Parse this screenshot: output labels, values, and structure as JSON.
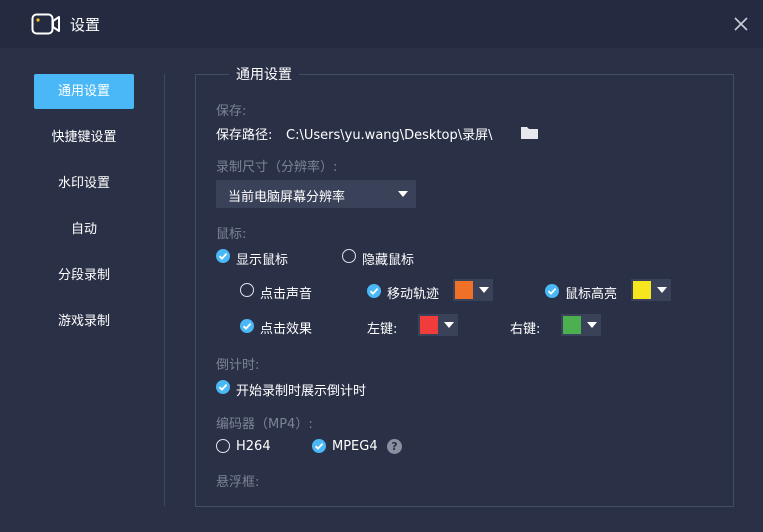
{
  "window": {
    "title": "设置",
    "icon": "camera-icon",
    "close_icon": "close-icon"
  },
  "sidebar": {
    "items": [
      {
        "label": "通用设置",
        "active": true
      },
      {
        "label": "快捷键设置",
        "active": false
      },
      {
        "label": "水印设置",
        "active": false
      },
      {
        "label": "自动",
        "active": false
      },
      {
        "label": "分段录制",
        "active": false
      },
      {
        "label": "游戏录制",
        "active": false
      }
    ]
  },
  "panel": {
    "legend": "通用设置",
    "save": {
      "section_label": "保存:",
      "path_label": "保存路径:",
      "path_value": "C:\\Users\\yu.wang\\Desktop\\录屏\\",
      "folder_icon": "folder-icon"
    },
    "record_size": {
      "section_label": "录制尺寸（分辨率）:",
      "selected": "当前电脑屏幕分辨率"
    },
    "mouse": {
      "section_label": "鼠标:",
      "show_cursor": {
        "label": "显示鼠标",
        "checked": true
      },
      "hide_cursor": {
        "label": "隐藏鼠标",
        "checked": false
      },
      "click_sound": {
        "label": "点击声音",
        "checked": false
      },
      "move_trail": {
        "label": "移动轨迹",
        "checked": true,
        "color": "#f07028"
      },
      "cursor_highlight": {
        "label": "鼠标高亮",
        "checked": true,
        "color": "#f5e61e"
      },
      "click_effect": {
        "label": "点击效果",
        "checked": true
      },
      "left_key": {
        "label": "左键:",
        "color": "#f23c3c"
      },
      "right_key": {
        "label": "右键:",
        "color": "#4caf50"
      }
    },
    "countdown": {
      "section_label": "倒计时:",
      "show_countdown": {
        "label": "开始录制时展示倒计时",
        "checked": true
      }
    },
    "encoder": {
      "section_label": "编码器（MP4）:",
      "h264": {
        "label": "H264",
        "checked": false
      },
      "mpeg4": {
        "label": "MPEG4",
        "checked": true
      },
      "help_icon": "question-icon",
      "help_glyph": "?"
    },
    "floating": {
      "section_label": "悬浮框:"
    }
  },
  "colors": {
    "accent": "#4ab8f6",
    "background": "#2a3147",
    "titlebar": "#242b40"
  }
}
